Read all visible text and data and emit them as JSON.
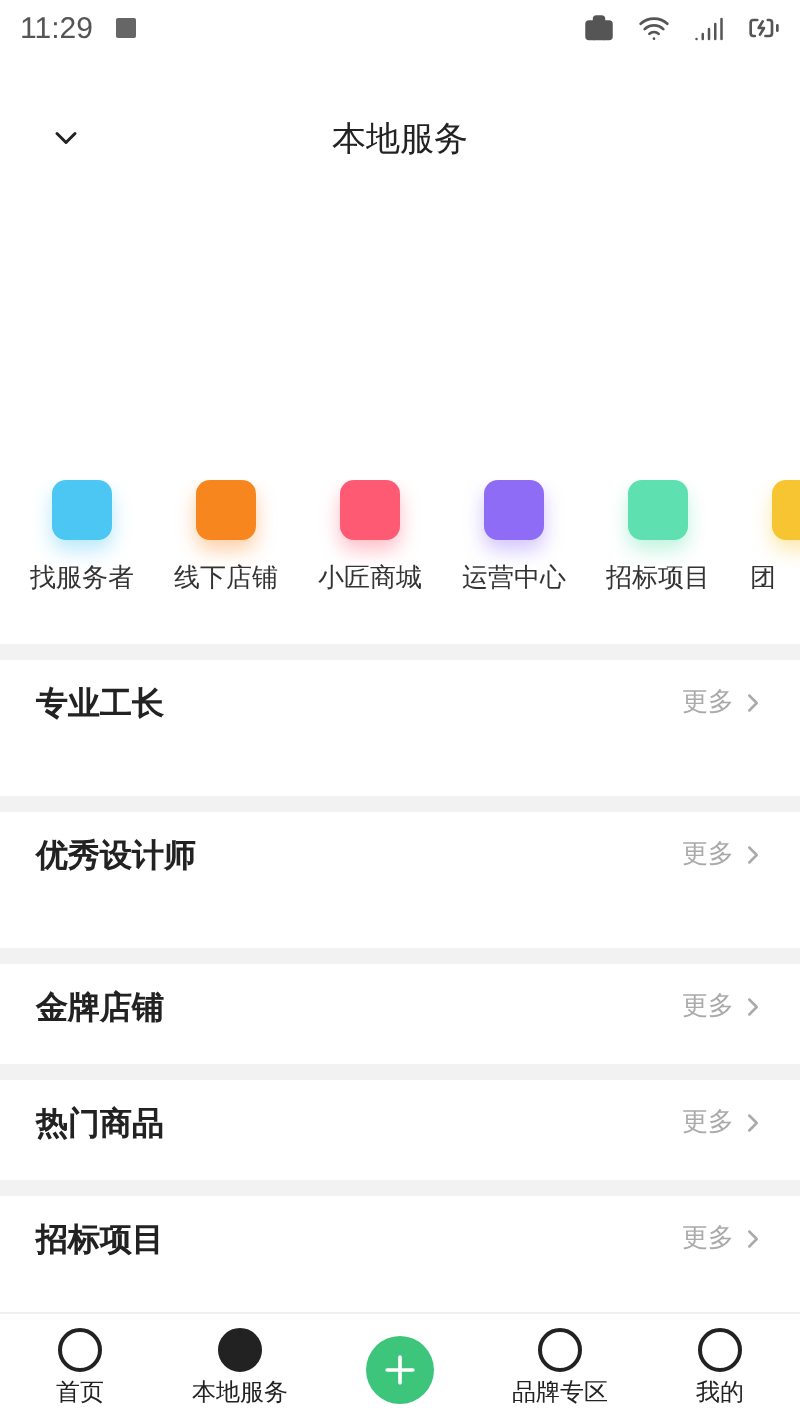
{
  "status_bar": {
    "time": "11:29"
  },
  "header": {
    "title": "本地服务"
  },
  "categories": [
    {
      "label": "找服务者",
      "color": "#4cc6f2"
    },
    {
      "label": "线下店铺",
      "color": "#f7861e"
    },
    {
      "label": "小匠商城",
      "color": "#ff5a73"
    },
    {
      "label": "运营中心",
      "color": "#8f6cf6"
    },
    {
      "label": "招标项目",
      "color": "#5ee0b0"
    },
    {
      "label": "团",
      "color": "#f7c531"
    }
  ],
  "sections": [
    {
      "title": "专业工长",
      "more": "更多",
      "tall": true
    },
    {
      "title": "优秀设计师",
      "more": "更多",
      "tall": true
    },
    {
      "title": "金牌店铺",
      "more": "更多",
      "tall": false
    },
    {
      "title": "热门商品",
      "more": "更多",
      "tall": false
    },
    {
      "title": "招标项目",
      "more": "更多",
      "tall": false
    }
  ],
  "tab_bar": [
    {
      "kind": "tab",
      "label": "首页",
      "selected": false
    },
    {
      "kind": "tab",
      "label": "本地服务",
      "selected": true
    },
    {
      "kind": "add"
    },
    {
      "kind": "tab",
      "label": "品牌专区",
      "selected": false
    },
    {
      "kind": "tab",
      "label": "我的",
      "selected": false
    }
  ]
}
